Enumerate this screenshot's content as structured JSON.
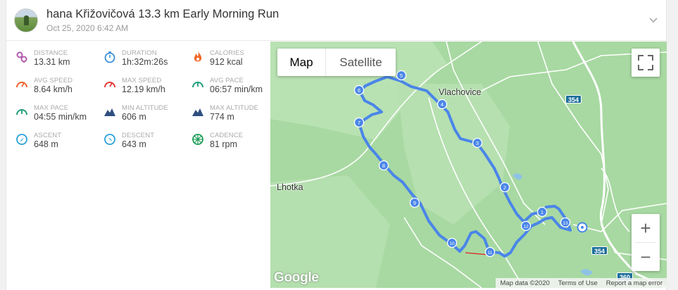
{
  "header": {
    "athlete_name": "hana Křižovičová",
    "activity_title": "13.3 km Early Morning Run",
    "date": "Oct 25, 2020 6:42 AM",
    "expand_icon": "chevron-down-icon"
  },
  "stats": [
    {
      "label": "DISTANCE",
      "value": "13.31 km",
      "icon": "distance-icon",
      "color": "#b35bb0"
    },
    {
      "label": "DURATION",
      "value": "1h:32m:26s",
      "icon": "stopwatch-icon",
      "color": "#3b8fd6"
    },
    {
      "label": "CALORIES",
      "value": "912 kcal",
      "icon": "flame-icon",
      "color": "#f06a2a"
    },
    {
      "label": "AVG SPEED",
      "value": "8.64 km/h",
      "icon": "speedometer-icon",
      "color": "#f0622a"
    },
    {
      "label": "MAX SPEED",
      "value": "12.19 km/h",
      "icon": "speedometer-icon",
      "color": "#e33b3b"
    },
    {
      "label": "AVG PACE",
      "value": "06:57 min/km",
      "icon": "pace-gauge-icon",
      "color": "#1f9e7a"
    },
    {
      "label": "MAX PACE",
      "value": "04:55 min/km",
      "icon": "pace-gauge-icon",
      "color": "#1f9e7a"
    },
    {
      "label": "MIN ALTITUDE",
      "value": "606 m",
      "icon": "mountain-icon",
      "color": "#2f4f7f"
    },
    {
      "label": "MAX ALTITUDE",
      "value": "774 m",
      "icon": "mountain-icon",
      "color": "#2f4f7f"
    },
    {
      "label": "ASCENT",
      "value": "648 m",
      "icon": "ascent-compass-icon",
      "color": "#2aa0d8"
    },
    {
      "label": "DESCENT",
      "value": "643 m",
      "icon": "descent-compass-icon",
      "color": "#2aa0d8"
    },
    {
      "label": "CADENCE",
      "value": "81 rpm",
      "icon": "cadence-wheel-icon",
      "color": "#1f9e5a"
    }
  ],
  "map": {
    "tabs": [
      {
        "label": "Map",
        "active": true
      },
      {
        "label": "Satellite",
        "active": false
      }
    ],
    "places": [
      "Vlachovice",
      "Lhotka"
    ],
    "road_numbers": [
      "354",
      "354",
      "360"
    ],
    "markers": [
      "1",
      "2",
      "3",
      "4",
      "5",
      "6",
      "7",
      "8",
      "9",
      "10",
      "11",
      "12",
      "13"
    ],
    "zoom_in": "+",
    "zoom_out": "−",
    "logo": "Google",
    "attribution": {
      "map_data": "Map data ©2020",
      "terms": "Terms of Use",
      "report": "Report a map error"
    },
    "colors": {
      "route": "#4a86e8",
      "land": "#a8d9a2",
      "road": "#ffffff"
    }
  }
}
